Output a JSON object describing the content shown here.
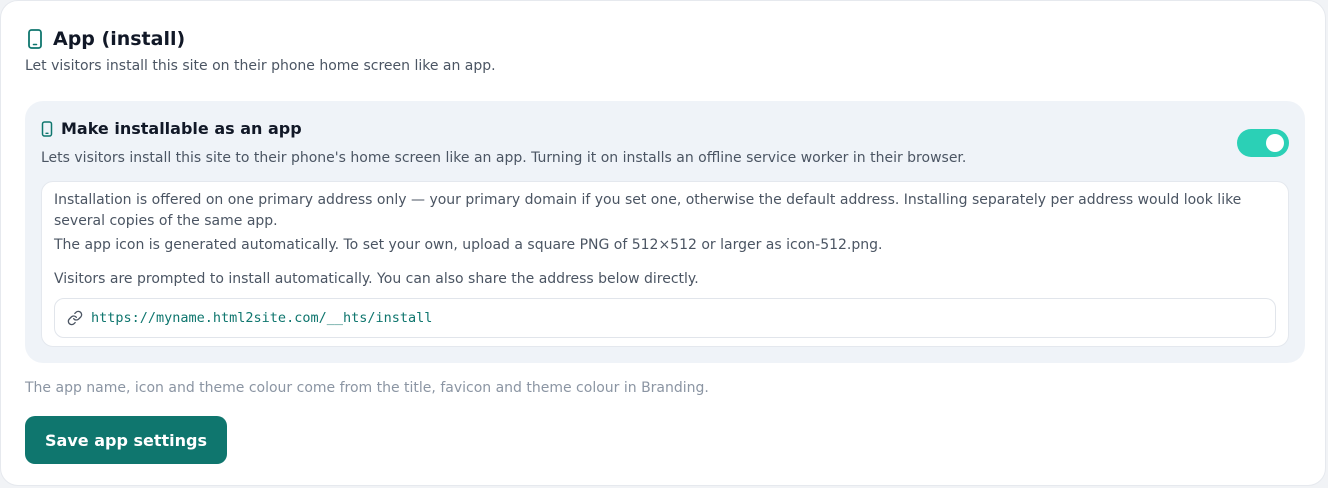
{
  "section": {
    "icon": "phone-icon",
    "title": "App (install)",
    "subtitle": "Let visitors install this site on their phone home screen like an app."
  },
  "panel": {
    "icon": "phone-icon",
    "title": "Make installable as an app",
    "description": "Lets visitors install this site to their phone's home screen like an app. Turning it on installs an offline service worker in their browser.",
    "toggle_on": true,
    "info": {
      "line1": "Installation is offered on one primary address only — your primary domain if you set one, otherwise the default address. Installing separately per address would look like several copies of the same app.",
      "line2": "The app icon is generated automatically. To set your own, upload a square PNG of 512×512 or larger as icon-512.png.",
      "line3": "Visitors are prompted to install automatically. You can also share the address below directly.",
      "url_icon": "link-icon",
      "url": "https://myname.html2site.com/__hts/install"
    }
  },
  "footnote": "The app name, icon and theme colour come from the title, favicon and theme colour in Branding.",
  "save_button": "Save app settings",
  "colors": {
    "accent": "#0f766e",
    "toggle": "#2bd0b6",
    "panel_bg": "#eff3f8"
  }
}
